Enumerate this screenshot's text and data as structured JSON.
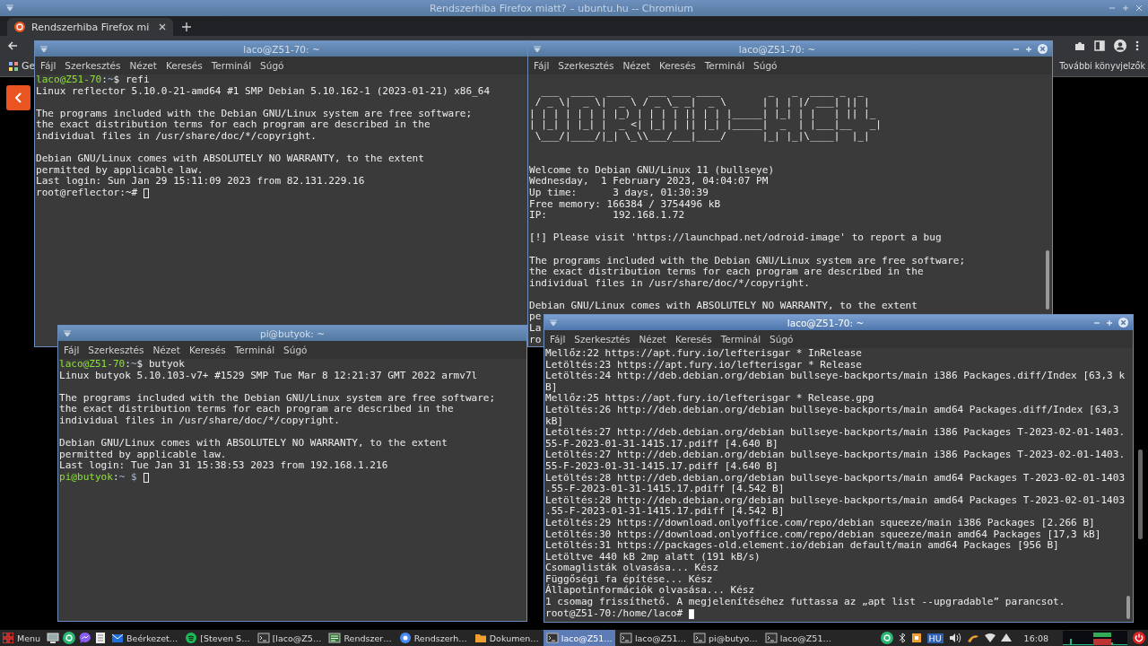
{
  "browser": {
    "title": "Rendszerhiba Firefox miatt? – ubuntu.hu -- Chromium",
    "tabs": [
      {
        "title": "Rendszerhiba Firefox mi",
        "selected": true
      }
    ],
    "bookmarks": [
      {
        "label": "Ge"
      }
    ],
    "more_bookmarks": "További könyvjelzők"
  },
  "windows": [
    {
      "title": "laco@Z51-70: ~",
      "focused": false,
      "buttons_shown": false,
      "scrollbar": false,
      "menu": [
        "Fájl",
        "Szerkesztés",
        "Nézet",
        "Keresés",
        "Terminál",
        "Súgó"
      ],
      "lines": [
        {
          "kind": "prompt",
          "parts": [
            {
              "kind": "user",
              "text": "laco@Z51-70"
            },
            {
              "kind": "plain",
              "text": ":"
            },
            {
              "kind": "path",
              "text": "~"
            },
            {
              "kind": "plain",
              "text": "$ refi"
            }
          ]
        },
        {
          "kind": "text",
          "text": "Linux reflector 5.10.0-21-amd64 #1 SMP Debian 5.10.162-1 (2023-01-21) x86_64"
        },
        {
          "kind": "blank"
        },
        {
          "kind": "text",
          "text": "The programs included with the Debian GNU/Linux system are free software;"
        },
        {
          "kind": "text",
          "text": "the exact distribution terms for each program are described in the"
        },
        {
          "kind": "text",
          "text": "individual files in /usr/share/doc/*/copyright."
        },
        {
          "kind": "blank"
        },
        {
          "kind": "text",
          "text": "Debian GNU/Linux comes with ABSOLUTELY NO WARRANTY, to the extent"
        },
        {
          "kind": "text",
          "text": "permitted by applicable law."
        },
        {
          "kind": "text",
          "text": "Last login: Sun Jan 29 15:11:09 2023 from 82.131.229.16"
        },
        {
          "kind": "text",
          "text": "root@reflector:~#",
          "cursor": true
        }
      ]
    },
    {
      "title": "laco@Z51-70: ~",
      "focused": false,
      "buttons_shown": true,
      "scrollbar": true,
      "menu": [
        "Fájl",
        "Szerkesztés",
        "Nézet",
        "Keresés",
        "Terminál",
        "Súgó"
      ],
      "lines": [
        {
          "kind": "blank"
        },
        {
          "kind": "art",
          "text": "  ___  ____  ____   ___ ___ ____        _   _  ____ _  _"
        },
        {
          "kind": "art",
          "text": " / _ \\|  _ \\|  _ \\ / _ \\_ _|  _ \\      | | | |/ ___| || |"
        },
        {
          "kind": "art",
          "text": "| | | | | | | |_) | | | | || | | |_____| |_| | |   | || |_"
        },
        {
          "kind": "art",
          "text": "| |_| | |_| |  _ <| |_| | || |_| |_____|  _  | |___|__   _|"
        },
        {
          "kind": "art",
          "text": " \\___/|____/|_| \\_\\\\___/___|____/      |_| |_|\\____|  |_|"
        },
        {
          "kind": "blank"
        },
        {
          "kind": "blank"
        },
        {
          "kind": "text",
          "text": "Welcome to Debian GNU/Linux 11 (bullseye)"
        },
        {
          "kind": "text",
          "text": "Wednesday,  1 February 2023, 04:04:07 PM"
        },
        {
          "kind": "text",
          "text": "Up time:      3 days, 01:30:39"
        },
        {
          "kind": "text",
          "text": "Free memory: 166384 / 3754496 kB"
        },
        {
          "kind": "text",
          "text": "IP:           192.168.1.72"
        },
        {
          "kind": "blank"
        },
        {
          "kind": "text",
          "text": "[!] Please visit 'https://launchpad.net/odroid-image' to report a bug"
        },
        {
          "kind": "blank"
        },
        {
          "kind": "text",
          "text": "The programs included with the Debian GNU/Linux system are free software;"
        },
        {
          "kind": "text",
          "text": "the exact distribution terms for each program are described in the"
        },
        {
          "kind": "text",
          "text": "individual files in /usr/share/doc/*/copyright."
        },
        {
          "kind": "blank"
        },
        {
          "kind": "text",
          "text": "Debian GNU/Linux comes with ABSOLUTELY NO WARRANTY, to the extent"
        },
        {
          "kind": "text",
          "text": "pe"
        },
        {
          "kind": "text",
          "text": "La"
        },
        {
          "kind": "text",
          "text": "ro"
        }
      ]
    },
    {
      "title": "pi@butyok: ~",
      "focused": false,
      "buttons_shown": false,
      "scrollbar": false,
      "menu": [
        "Fájl",
        "Szerkesztés",
        "Nézet",
        "Keresés",
        "Terminál",
        "Súgó"
      ],
      "lines": [
        {
          "kind": "prompt",
          "parts": [
            {
              "kind": "user",
              "text": "laco@Z51-70"
            },
            {
              "kind": "plain",
              "text": ":"
            },
            {
              "kind": "path",
              "text": "~"
            },
            {
              "kind": "plain",
              "text": "$ butyok"
            }
          ]
        },
        {
          "kind": "text",
          "text": "Linux butyok 5.10.103-v7+ #1529 SMP Tue Mar 8 12:21:37 GMT 2022 armv7l"
        },
        {
          "kind": "blank"
        },
        {
          "kind": "text",
          "text": "The programs included with the Debian GNU/Linux system are free software;"
        },
        {
          "kind": "text",
          "text": "the exact distribution terms for each program are described in the"
        },
        {
          "kind": "text",
          "text": "individual files in /usr/share/doc/*/copyright."
        },
        {
          "kind": "blank"
        },
        {
          "kind": "text",
          "text": "Debian GNU/Linux comes with ABSOLUTELY NO WARRANTY, to the extent"
        },
        {
          "kind": "text",
          "text": "permitted by applicable law."
        },
        {
          "kind": "text",
          "text": "Last login: Tue Jan 31 15:38:53 2023 from 192.168.1.216"
        },
        {
          "kind": "prompt",
          "cursor": true,
          "parts": [
            {
              "kind": "user",
              "text": "pi@butyok"
            },
            {
              "kind": "plain",
              "text": ":"
            },
            {
              "kind": "path",
              "text": "~ $"
            }
          ]
        }
      ]
    },
    {
      "title": "laco@Z51-70: ~",
      "focused": true,
      "buttons_shown": true,
      "scrollbar": true,
      "menu": [
        "Fájl",
        "Szerkesztés",
        "Nézet",
        "Keresés",
        "Terminál",
        "Súgó"
      ],
      "lines": [
        {
          "kind": "text",
          "text": "Mellőz:22 https://apt.fury.io/lefterisgar * InRelease"
        },
        {
          "kind": "text",
          "text": "Letöltés:23 https://apt.fury.io/lefterisgar * Release"
        },
        {
          "kind": "text",
          "text": "Letöltés:24 http://deb.debian.org/debian bullseye-backports/main i386 Packages.diff/Index [63,3 k"
        },
        {
          "kind": "text",
          "text": "B]"
        },
        {
          "kind": "text",
          "text": "Mellőz:25 https://apt.fury.io/lefterisgar * Release.gpg"
        },
        {
          "kind": "text",
          "text": "Letöltés:26 http://deb.debian.org/debian bullseye-backports/main amd64 Packages.diff/Index [63,3"
        },
        {
          "kind": "text",
          "text": "kB]"
        },
        {
          "kind": "text",
          "text": "Letöltés:27 http://deb.debian.org/debian bullseye-backports/main i386 Packages T-2023-02-01-1403."
        },
        {
          "kind": "text",
          "text": "55-F-2023-01-31-1415.17.pdiff [4.640 B]"
        },
        {
          "kind": "text",
          "text": "Letöltés:27 http://deb.debian.org/debian bullseye-backports/main i386 Packages T-2023-02-01-1403."
        },
        {
          "kind": "text",
          "text": "55-F-2023-01-31-1415.17.pdiff [4.640 B]"
        },
        {
          "kind": "text",
          "text": "Letöltés:28 http://deb.debian.org/debian bullseye-backports/main amd64 Packages T-2023-02-01-1403"
        },
        {
          "kind": "text",
          "text": ".55-F-2023-01-31-1415.17.pdiff [4.542 B]"
        },
        {
          "kind": "text",
          "text": "Letöltés:28 http://deb.debian.org/debian bullseye-backports/main amd64 Packages T-2023-02-01-1403"
        },
        {
          "kind": "text",
          "text": ".55-F-2023-01-31-1415.17.pdiff [4.542 B]"
        },
        {
          "kind": "text",
          "text": "Letöltés:29 https://download.onlyoffice.com/repo/debian squeeze/main i386 Packages [2.266 B]"
        },
        {
          "kind": "text",
          "text": "Letöltés:30 https://download.onlyoffice.com/repo/debian squeeze/main amd64 Packages [17,3 kB]"
        },
        {
          "kind": "text",
          "text": "Letöltés:31 https://packages-old.element.io/debian default/main amd64 Packages [956 B]"
        },
        {
          "kind": "text",
          "text": "Letöltve 440 kB 2mp alatt (191 kB/s)"
        },
        {
          "kind": "text",
          "text": "Csomaglisták olvasása... Kész"
        },
        {
          "kind": "text",
          "text": "Függőségi fa építése... Kész"
        },
        {
          "kind": "text",
          "text": "Állapotinformációk olvasása... Kész"
        },
        {
          "kind": "text",
          "text": "1 csomag frissíthető. A megjelenítéséhez futtassa az „apt list --upgradable” parancsot."
        },
        {
          "kind": "text",
          "text": "root@Z51-70:/home/laco#",
          "cursor": true
        }
      ]
    }
  ],
  "taskbar": {
    "menu_label": "Menu",
    "apps": [
      {
        "kind": "mail",
        "label": "Beérkezet…",
        "selected": false
      },
      {
        "kind": "music",
        "label": "[Steven S…",
        "selected": false
      },
      {
        "kind": "terminal",
        "label": "[laco@Z5…",
        "selected": false
      },
      {
        "kind": "editor",
        "label": "Rendszer…",
        "selected": false
      },
      {
        "kind": "browser",
        "label": "Rendszerh…",
        "selected": false
      },
      {
        "kind": "folder",
        "label": "Dokumen…",
        "selected": false
      },
      {
        "kind": "terminal",
        "label": "laco@Z51…",
        "selected": true
      },
      {
        "kind": "terminal",
        "label": "laco@Z51…",
        "selected": false
      },
      {
        "kind": "terminal",
        "label": "pi@butyo…",
        "selected": false
      },
      {
        "kind": "terminal",
        "label": "laco@Z51…",
        "selected": false
      }
    ],
    "keyboard": "HU",
    "clock": "16:08"
  }
}
